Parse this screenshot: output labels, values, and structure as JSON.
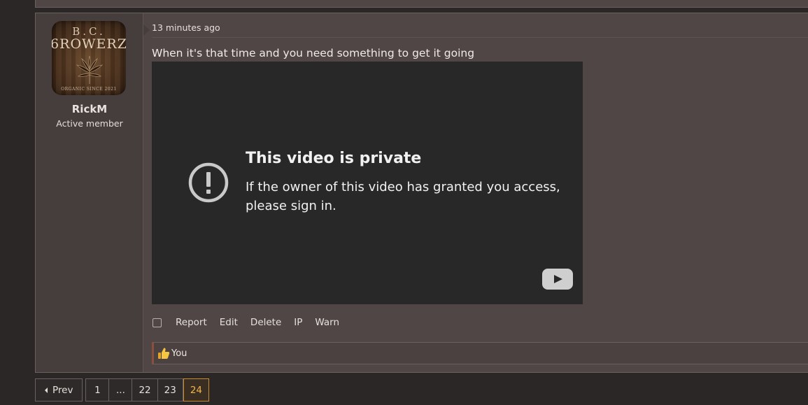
{
  "post": {
    "timestamp": "13 minutes ago",
    "text": "When it's that time and you need something to get it going"
  },
  "user": {
    "name": "RickM",
    "title": "Active member",
    "avatar": {
      "line1": "B.C.",
      "line2": "6ROWERZ",
      "line3": "ORGANIC SINCE 2021"
    }
  },
  "video": {
    "title": "This video is private",
    "message": "If the owner of this video has granted you access, please sign in.",
    "icon": "alert-circle-icon",
    "logo": "youtube-logo-icon"
  },
  "actions": {
    "report": "Report",
    "edit": "Edit",
    "delete": "Delete",
    "ip": "IP",
    "warn": "Warn"
  },
  "reactions": {
    "icon": "thumbs-up-icon",
    "label": "You"
  },
  "pagination": {
    "prev": "Prev",
    "pages": [
      "1",
      "...",
      "22",
      "23",
      "24"
    ],
    "current": "24"
  },
  "colors": {
    "accent_current_page": "#c68a2f",
    "reaction_bar_accent": "#8a4f3d",
    "background": "#2b2726",
    "post_background": "#4f4645"
  }
}
